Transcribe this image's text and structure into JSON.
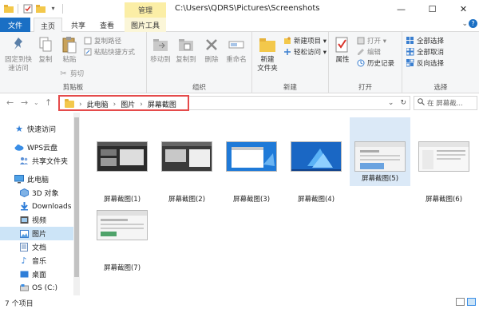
{
  "titlebar": {
    "context_tab": "管理",
    "path": "C:\\Users\\QDRS\\Pictures\\Screenshots",
    "minimize": "—",
    "maximize": "☐",
    "close": "✕"
  },
  "tabs": {
    "file": "文件",
    "home": "主页",
    "share": "共享",
    "view": "查看",
    "picture_tools": "图片工具"
  },
  "ribbon": {
    "clipboard": {
      "label": "剪贴板",
      "pin": "固定到快\n速访问",
      "copy": "复制",
      "paste": "粘贴",
      "copy_path": "复制路径",
      "paste_shortcut": "粘贴快捷方式",
      "cut": "剪切"
    },
    "organize": {
      "label": "组织",
      "move_to": "移动到",
      "copy_to": "复制到",
      "delete": "删除",
      "rename": "重命名"
    },
    "new": {
      "label": "新建",
      "new_folder": "新建\n文件夹",
      "new_item": "新建项目 ▾",
      "easy_access": "轻松访问 ▾"
    },
    "open": {
      "label": "打开",
      "properties": "属性",
      "open": "打开 ▾",
      "edit": "编辑",
      "history": "历史记录"
    },
    "select": {
      "label": "选择",
      "select_all": "全部选择",
      "select_none": "全部取消",
      "invert": "反向选择"
    }
  },
  "address": {
    "crumbs": [
      "此电脑",
      "图片",
      "屏幕截图"
    ],
    "search_placeholder": "在 屏幕截..."
  },
  "nav": {
    "items": [
      {
        "label": "快速访问",
        "icon": "star-icon"
      },
      {
        "label": "WPS云盘",
        "icon": "cloud-icon"
      },
      {
        "label": "共享文件夹",
        "icon": "shared-folder-icon"
      },
      {
        "label": "此电脑",
        "icon": "computer-icon"
      },
      {
        "label": "3D 对象",
        "icon": "cube-icon"
      },
      {
        "label": "Downloads",
        "icon": "download-icon"
      },
      {
        "label": "视频",
        "icon": "video-icon"
      },
      {
        "label": "图片",
        "icon": "pictures-icon"
      },
      {
        "label": "文档",
        "icon": "document-icon"
      },
      {
        "label": "音乐",
        "icon": "music-icon"
      },
      {
        "label": "桌面",
        "icon": "desktop-icon"
      },
      {
        "label": "OS (C:)",
        "icon": "drive-icon"
      }
    ]
  },
  "files": [
    {
      "name": "屏幕截图(1)",
      "style": "dark"
    },
    {
      "name": "屏幕截图(2)",
      "style": "dark"
    },
    {
      "name": "屏幕截图(3)",
      "style": "blue"
    },
    {
      "name": "屏幕截图(4)",
      "style": "blue"
    },
    {
      "name": "屏幕截图(5)",
      "style": "light"
    },
    {
      "name": "屏幕截图(6)",
      "style": "light"
    },
    {
      "name": "屏幕截图(7)",
      "style": "light"
    }
  ],
  "status": {
    "count": "7 个项目"
  },
  "colors": {
    "accent": "#1a6fc4",
    "highlight_box": "#e54b4b",
    "selected": "#cce4f7"
  }
}
